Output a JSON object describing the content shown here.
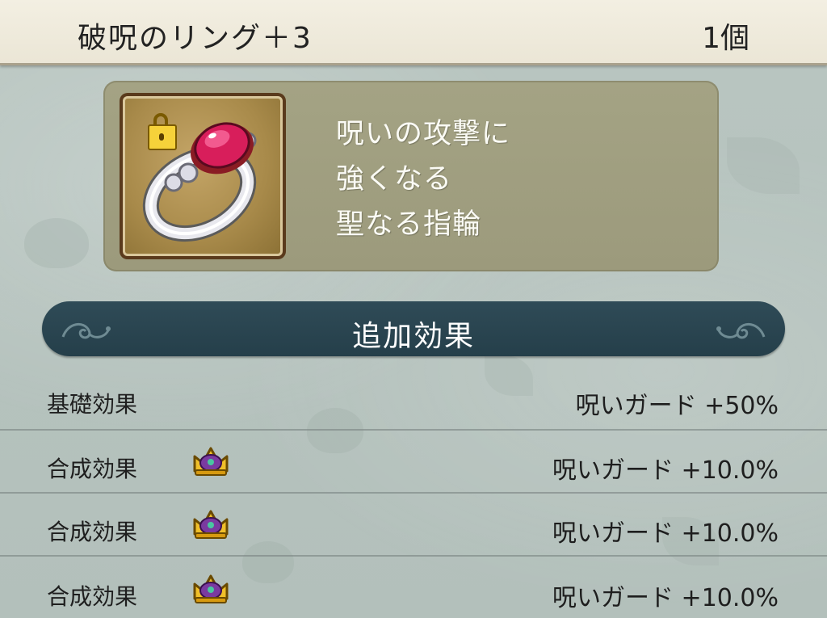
{
  "item": {
    "name": "破呪のリング＋3",
    "count": "1個",
    "locked": true,
    "description": [
      "呪いの攻撃に",
      "強くなる",
      "聖なる指輪"
    ]
  },
  "section": {
    "title": "追加効果"
  },
  "effects": [
    {
      "label": "基礎効果",
      "value": "呪いガード +50%",
      "icon": ""
    },
    {
      "label": "合成効果",
      "value": "呪いガード +10.0%",
      "icon": "crown-icon"
    },
    {
      "label": "合成効果",
      "value": "呪いガード +10.0%",
      "icon": "crown-icon"
    },
    {
      "label": "合成効果",
      "value": "呪いガード +10.0%",
      "icon": "crown-icon"
    }
  ],
  "colors": {
    "banner": "#2a4550",
    "card": "#a09f80",
    "header": "#efeadc",
    "gem": "#d81e5b"
  }
}
